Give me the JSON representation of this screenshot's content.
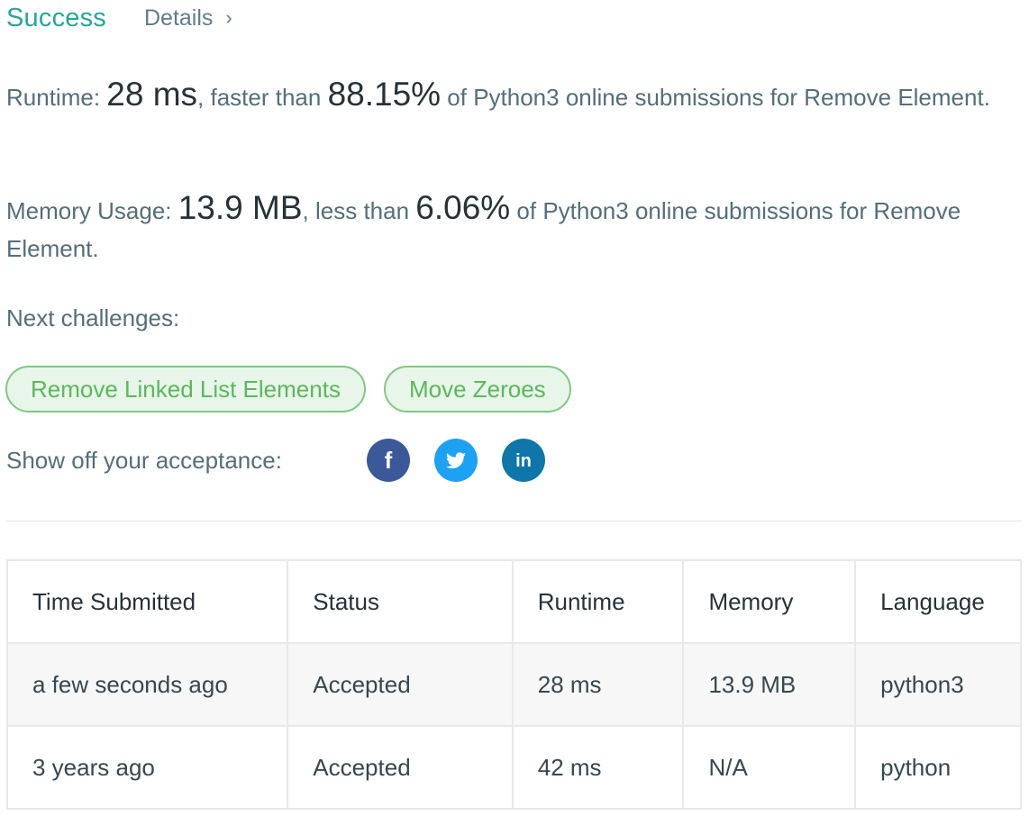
{
  "header": {
    "status": "Success",
    "details_label": "Details",
    "details_chevron": "›"
  },
  "runtime_stat": {
    "label": "Runtime: ",
    "value": "28 ms",
    "mid": ", faster than ",
    "percent": "88.15%",
    "tail": " of Python3 online submissions for Remove Element."
  },
  "memory_stat": {
    "label": "Memory Usage: ",
    "value": "13.9 MB",
    "mid": ", less than ",
    "percent": "6.06%",
    "tail": " of Python3 online submissions for Remove Element."
  },
  "next_challenges": {
    "label": "Next challenges:",
    "items": [
      "Remove Linked List Elements",
      "Move Zeroes"
    ]
  },
  "share": {
    "label": "Show off your acceptance:",
    "icons": [
      "facebook-icon",
      "twitter-icon",
      "linkedin-icon"
    ],
    "colors": {
      "facebook": "#3b5998",
      "twitter": "#1da1f2",
      "linkedin": "#0e76a8"
    }
  },
  "table": {
    "headers": [
      "Time Submitted",
      "Status",
      "Runtime",
      "Memory",
      "Language"
    ],
    "rows": [
      {
        "time": "a few seconds ago",
        "status": "Accepted",
        "runtime": "28 ms",
        "memory": "13.9 MB",
        "language": "python3"
      },
      {
        "time": "3 years ago",
        "status": "Accepted",
        "runtime": "42 ms",
        "memory": "N/A",
        "language": "python"
      }
    ]
  },
  "colors": {
    "accent": "#26a69a",
    "chip_text": "#5cb85c",
    "chip_bg": "#e8f5e9",
    "chip_border": "#81c784"
  }
}
